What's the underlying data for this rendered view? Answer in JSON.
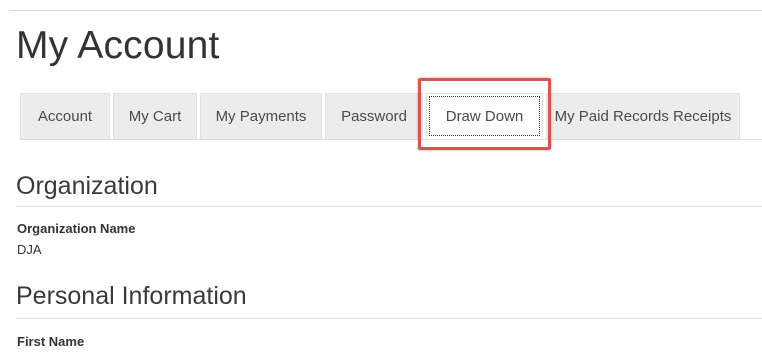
{
  "page": {
    "title": "My Account"
  },
  "tabs": [
    {
      "label": "Account"
    },
    {
      "label": "My Cart"
    },
    {
      "label": "My Payments"
    },
    {
      "label": "Password"
    },
    {
      "label": "Draw Down",
      "active": true
    },
    {
      "label": "My Paid Records Receipts"
    }
  ],
  "highlight": {
    "target": "Draw Down",
    "color": "#d9534f"
  },
  "sections": {
    "organization": {
      "heading": "Organization",
      "fields": [
        {
          "label": "Organization Name",
          "value": "DJA"
        }
      ]
    },
    "personal": {
      "heading": "Personal Information",
      "fields": [
        {
          "label": "First Name",
          "value": ""
        }
      ]
    }
  }
}
